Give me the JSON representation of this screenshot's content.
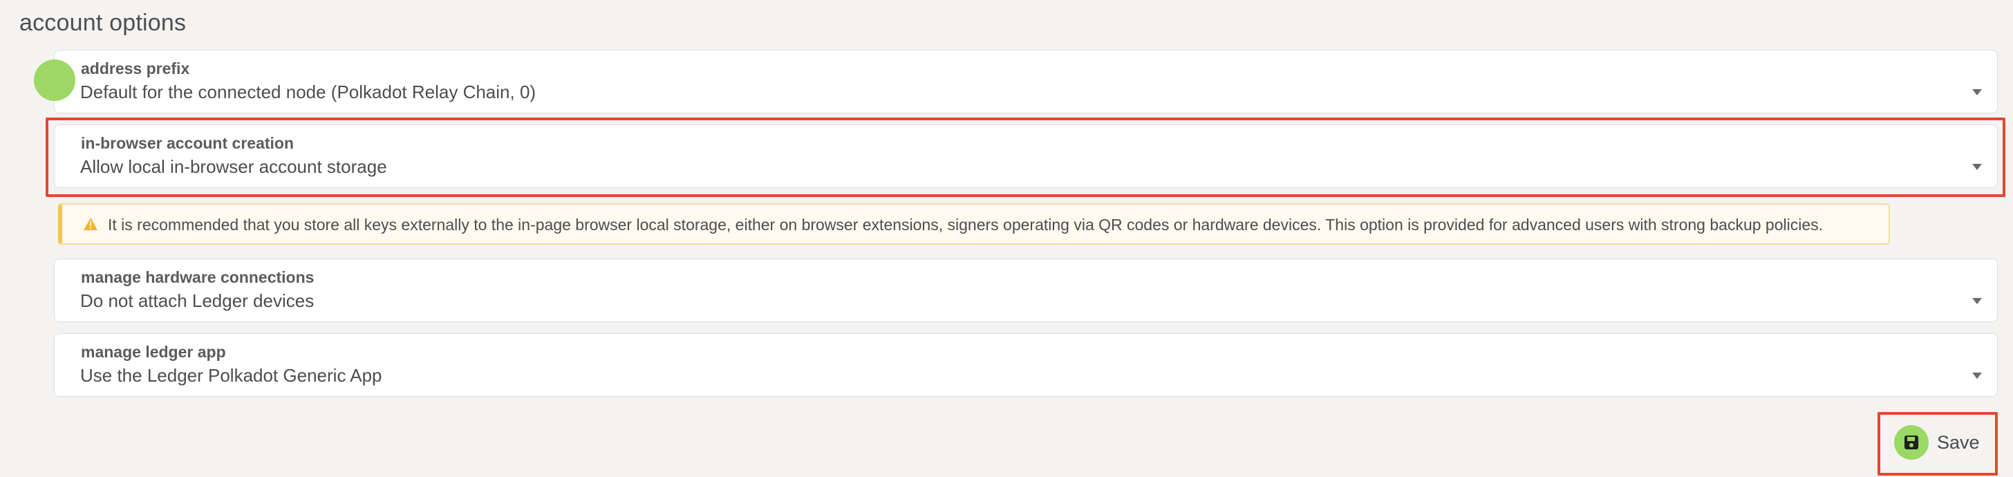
{
  "section": {
    "title": "account options"
  },
  "fields": [
    {
      "label": "address prefix",
      "value": "Default for the connected node (Polkadot Relay Chain, 0)"
    },
    {
      "label": "in-browser account creation",
      "value": "Allow local in-browser account storage"
    },
    {
      "label": "manage hardware connections",
      "value": "Do not attach Ledger devices"
    },
    {
      "label": "manage ledger app",
      "value": "Use the Ledger Polkadot Generic App"
    }
  ],
  "warning": {
    "text": "It is recommended that you store all keys externally to the in-page browser local storage, either on browser extensions, signers operating via QR codes or hardware devices. This option is provided for advanced users with strong backup policies.",
    "icon": "warning-triangle-icon"
  },
  "actions": {
    "save_label": "Save",
    "save_icon": "save-icon"
  },
  "colors": {
    "accent_green": "#99d964",
    "highlight_red": "#e04a2e",
    "warning_border": "#f1c84a"
  }
}
